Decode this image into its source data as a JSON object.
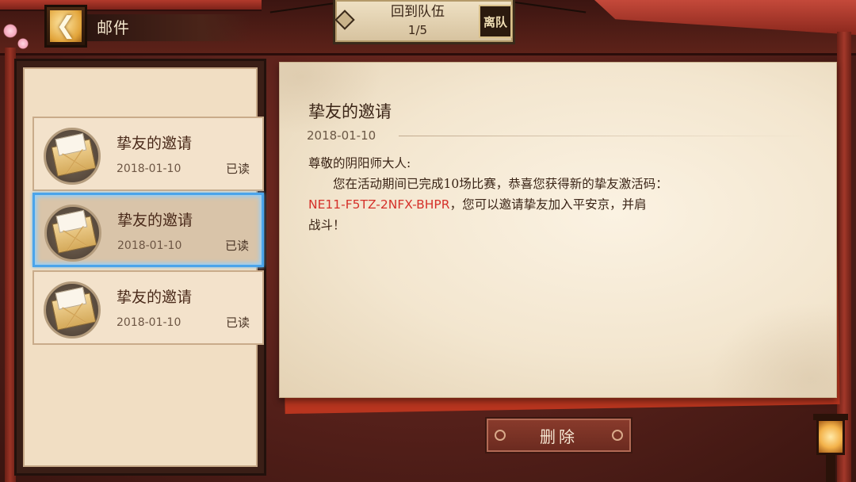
{
  "header": {
    "title": "邮件",
    "back_icon": "chevron-left-icon"
  },
  "team": {
    "label": "回到队伍",
    "count": "1/5",
    "leave_label": "离队"
  },
  "mail_list": [
    {
      "title": "挚友的邀请",
      "date": "2018-01-10",
      "status": "已读",
      "icon": "envelope-icon",
      "selected": false
    },
    {
      "title": "挚友的邀请",
      "date": "2018-01-10",
      "status": "已读",
      "icon": "envelope-icon",
      "selected": true
    },
    {
      "title": "挚友的邀请",
      "date": "2018-01-10",
      "status": "已读",
      "icon": "envelope-icon",
      "selected": false
    }
  ],
  "letter": {
    "title": "挚友的邀请",
    "date": "2018-01-10",
    "greeting": "尊敬的阴阳师大人:",
    "line1": "您在活动期间已完成10场比赛，恭喜您获得新的挚友激活码：",
    "code": "NE11-F5TZ-2NFX-BHPR",
    "line2_after_code": "，您可以邀请挚友加入平安京，并肩",
    "line3": "战斗！"
  },
  "actions": {
    "delete_label": "删除"
  },
  "colors": {
    "code_red": "#d5312a",
    "selected_border": "#4ba4ea"
  }
}
